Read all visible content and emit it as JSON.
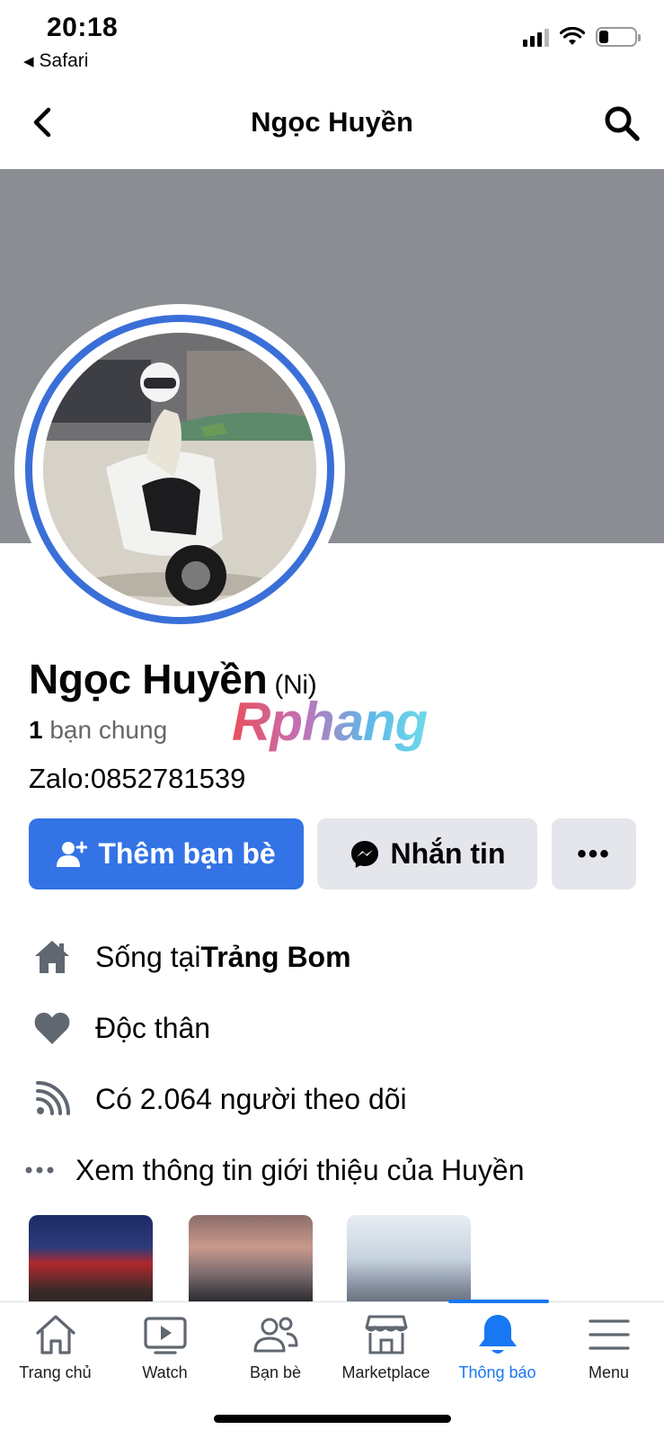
{
  "status_bar": {
    "time": "20:18",
    "back_app": "Safari",
    "icons": [
      "signal-icon",
      "wifi-icon",
      "battery-icon"
    ]
  },
  "header": {
    "title": "Ngọc Huyền",
    "back_icon": "chevron-left-icon",
    "search_icon": "search-icon"
  },
  "profile": {
    "name": "Ngọc Huyền",
    "nickname": "(Ni)",
    "mutual_count": "1",
    "mutual_label": " bạn chung",
    "bio": "Zalo:0852781539",
    "watermark": "Rphang"
  },
  "actions": {
    "add_friend": "Thêm bạn bè",
    "message": "Nhắn tin",
    "more": "•••"
  },
  "info": {
    "lives_prefix": "Sống tại ",
    "lives_place": "Trảng Bom",
    "relationship": "Độc thân",
    "followers": "Có 2.064 người theo dõi",
    "see_about": "Xem thông tin giới thiệu của Huyền"
  },
  "tabs": [
    {
      "label": "Trang chủ",
      "icon": "home-icon"
    },
    {
      "label": "Watch",
      "icon": "video-icon"
    },
    {
      "label": "Bạn bè",
      "icon": "friends-icon"
    },
    {
      "label": "Marketplace",
      "icon": "store-icon"
    },
    {
      "label": "Thông báo",
      "icon": "bell-icon"
    },
    {
      "label": "Menu",
      "icon": "menu-icon"
    }
  ],
  "colors": {
    "accent": "#1877f2",
    "button_primary": "#3373e6",
    "button_secondary": "#e4e6eb",
    "cover": "#8a8d91",
    "avatar_ring": "#3a6fd8"
  }
}
